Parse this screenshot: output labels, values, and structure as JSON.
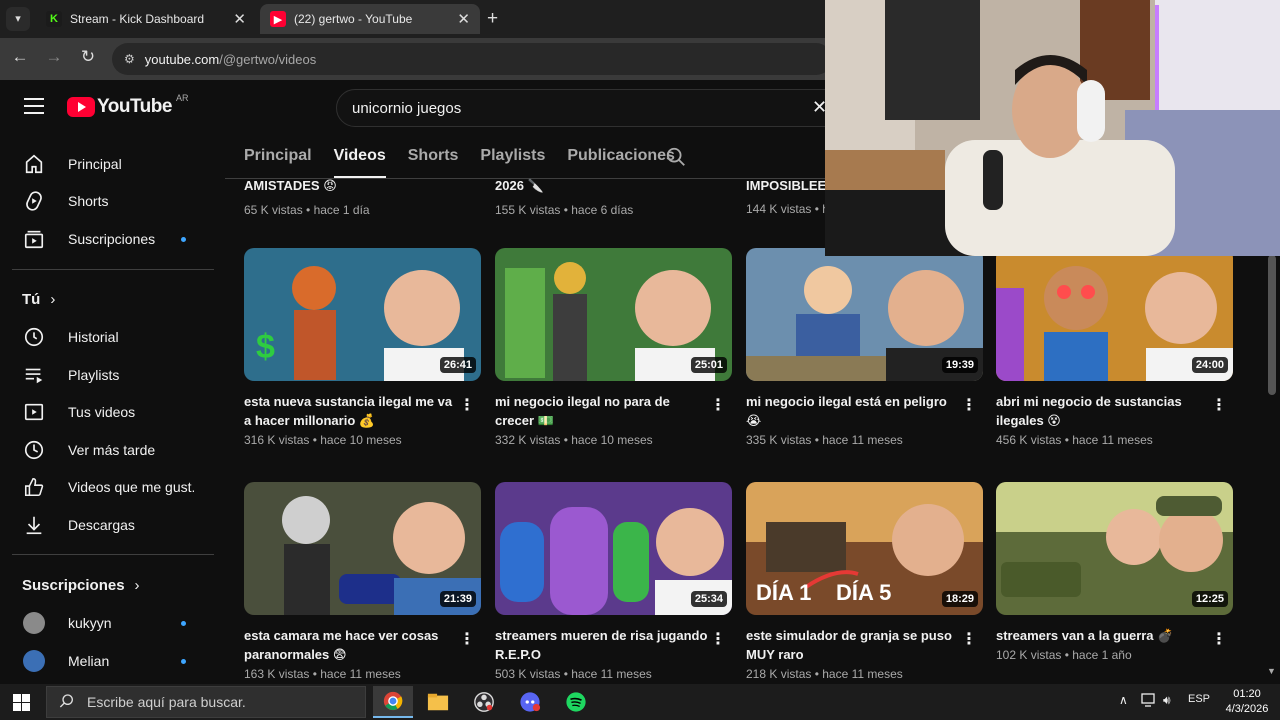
{
  "browser": {
    "tabs": [
      {
        "title": "Stream - Kick Dashboard",
        "active": false
      },
      {
        "title": "(22) gertwo - YouTube",
        "active": true
      }
    ],
    "url_host": "youtube.com",
    "url_path": "/@gertwo/videos"
  },
  "youtube": {
    "logo_text": "YouTube",
    "country_code": "AR",
    "search_query": "unicornio juegos"
  },
  "sidebar": {
    "main": [
      {
        "label": "Principal",
        "icon": "home-icon"
      },
      {
        "label": "Shorts",
        "icon": "shorts-icon"
      },
      {
        "label": "Suscripciones",
        "icon": "subscriptions-icon"
      }
    ],
    "you_heading": "Tú",
    "you": [
      {
        "label": "Historial",
        "icon": "history-icon"
      },
      {
        "label": "Playlists",
        "icon": "playlists-icon"
      },
      {
        "label": "Tus videos",
        "icon": "your-videos-icon"
      },
      {
        "label": "Ver más tarde",
        "icon": "watch-later-icon"
      },
      {
        "label": "Videos que me gust...",
        "icon": "liked-icon"
      },
      {
        "label": "Descargas",
        "icon": "download-icon"
      }
    ],
    "subs_heading": "Suscripciones",
    "subs": [
      {
        "label": "kukyyn"
      },
      {
        "label": "Melian"
      }
    ]
  },
  "channel_tabs": [
    "Principal",
    "Videos",
    "Shorts",
    "Playlists",
    "Publicaciones"
  ],
  "active_channel_tab": "Videos",
  "top_row": [
    {
      "title": "AMISTADES 😡",
      "meta": "65 K vistas • hace 1 día"
    },
    {
      "title": "2026 🔪",
      "meta": "155 K vistas • hace 6 días"
    },
    {
      "title": "IMPOSIBLEEE",
      "meta": "144 K vistas • h"
    }
  ],
  "videos": [
    {
      "title": "esta nueva sustancia ilegal me va a hacer millonario 💰",
      "views": "316 K vistas",
      "age": "hace 10 meses",
      "duration": "26:41",
      "thumb_color": "#2e6e8c"
    },
    {
      "title": "mi negocio ilegal no para de crecer 💵",
      "views": "332 K vistas",
      "age": "hace 10 meses",
      "duration": "25:01",
      "thumb_color": "#3f7a3a"
    },
    {
      "title": "mi negocio ilegal está en peligro 😭",
      "views": "335 K vistas",
      "age": "hace 11 meses",
      "duration": "19:39",
      "thumb_color": "#6c8fae"
    },
    {
      "title": "abri mi negocio de sustancias ilegales 😵",
      "views": "456 K vistas",
      "age": "hace 11 meses",
      "duration": "24:00",
      "thumb_color": "#c98b2e"
    },
    {
      "title": "esta camara me hace ver cosas paranormales 😨",
      "views": "163 K vistas",
      "age": "hace 11 meses",
      "duration": "21:39",
      "thumb_color": "#4a4f3c"
    },
    {
      "title": "streamers mueren de risa jugando R.E.P.O",
      "views": "503 K vistas",
      "age": "hace 11 meses",
      "duration": "25:34",
      "thumb_color": "#5b3a8c"
    },
    {
      "title": "este simulador de granja se puso MUY raro",
      "views": "218 K vistas",
      "age": "hace 11 meses",
      "duration": "18:29",
      "thumb_color": "#7a4a2a"
    },
    {
      "title": "streamers van a la guerra 💣",
      "views": "102 K vistas",
      "age": "hace 1 año",
      "duration": "12:25",
      "thumb_color": "#5d6b3a"
    }
  ],
  "thumb_captions": {
    "left": "DÍA 1",
    "right": "DÍA 5"
  },
  "taskbar": {
    "search_placeholder": "Escribe aquí para buscar.",
    "language": "ESP",
    "time": "01:20",
    "date": "4/3/2026"
  }
}
